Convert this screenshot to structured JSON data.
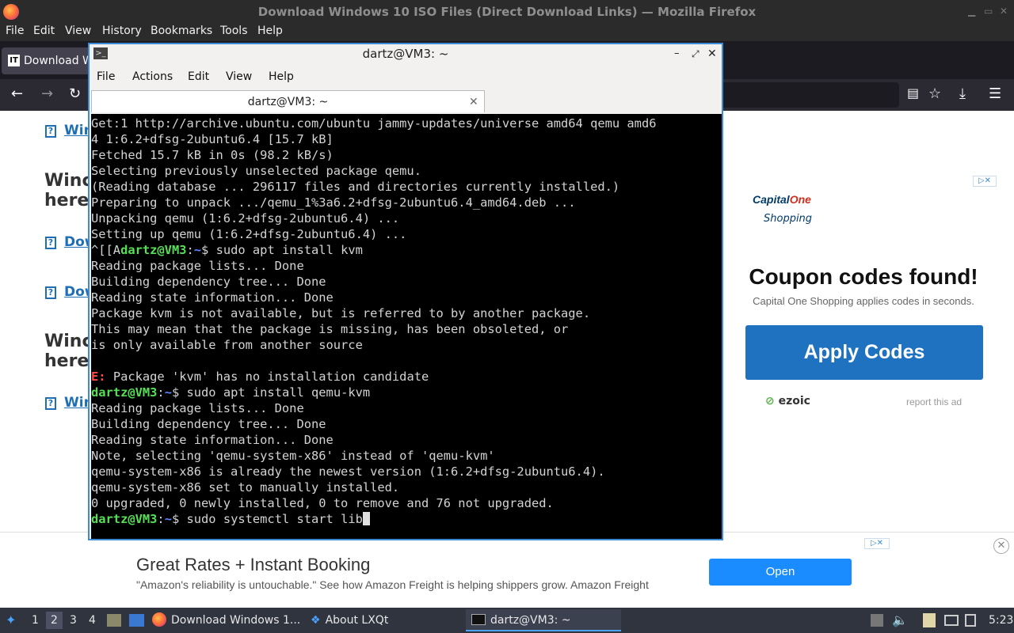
{
  "firefox": {
    "window_title": "Download Windows 10 ISO Files (Direct Download Links) — Mozilla Firefox",
    "menu": [
      "File",
      "Edit",
      "View",
      "History",
      "Bookmarks",
      "Tools",
      "Help"
    ],
    "tab_title": "Download W",
    "tab_icon_text": "IT"
  },
  "page": {
    "links": [
      "Win",
      "Dow",
      "Dow",
      "Win"
    ],
    "headings": [
      {
        "line1": "Winc",
        "line2": "here"
      },
      {
        "line1": "Winc",
        "line2": "here"
      }
    ],
    "ad_right": {
      "brand_top": "Capital",
      "brand_bottom": "One",
      "brand_sub": "Shopping",
      "headline": "Coupon codes found!",
      "sub": "Capital One Shopping applies codes in seconds.",
      "button": "Apply Codes",
      "ezoic": "ezoic",
      "report": "report this ad"
    },
    "ad_bottom": {
      "title": "Great Rates + Instant Booking",
      "desc": "\"Amazon's reliability is untouchable.\" See how Amazon Freight is helping shippers grow. Amazon Freight",
      "button": "Open"
    }
  },
  "terminal": {
    "title": "dartz@VM3: ~",
    "menu": [
      "File",
      "Actions",
      "Edit",
      "View",
      "Help"
    ],
    "tab": "dartz@VM3: ~",
    "lines": [
      {
        "t": "Get:1 http://archive.ubuntu.com/ubuntu jammy-updates/universe amd64 qemu amd6"
      },
      {
        "t": "4 1:6.2+dfsg-2ubuntu6.4 [15.7 kB]"
      },
      {
        "t": "Fetched 15.7 kB in 0s (98.2 kB/s)"
      },
      {
        "t": "Selecting previously unselected package qemu."
      },
      {
        "t": "(Reading database ... 296117 files and directories currently installed.)"
      },
      {
        "t": "Preparing to unpack .../qemu_1%3a6.2+dfsg-2ubuntu6.4_amd64.deb ..."
      },
      {
        "t": "Unpacking qemu (1:6.2+dfsg-2ubuntu6.4) ..."
      },
      {
        "t": "Setting up qemu (1:6.2+dfsg-2ubuntu6.4) ..."
      },
      {
        "pre": "^[[A",
        "user": "dartz@VM3",
        "path": "~",
        "cmd": "$ sudo apt install kvm"
      },
      {
        "t": "Reading package lists... Done"
      },
      {
        "t": "Building dependency tree... Done"
      },
      {
        "t": "Reading state information... Done"
      },
      {
        "t": "Package kvm is not available, but is referred to by another package."
      },
      {
        "t": "This may mean that the package is missing, has been obsoleted, or"
      },
      {
        "t": "is only available from another source"
      },
      {
        "t": ""
      },
      {
        "err": "E:",
        "t": " Package 'kvm' has no installation candidate"
      },
      {
        "user": "dartz@VM3",
        "path": "~",
        "cmd": "$ sudo apt install qemu-kvm"
      },
      {
        "t": "Reading package lists... Done"
      },
      {
        "t": "Building dependency tree... Done"
      },
      {
        "t": "Reading state information... Done"
      },
      {
        "t": "Note, selecting 'qemu-system-x86' instead of 'qemu-kvm'"
      },
      {
        "t": "qemu-system-x86 is already the newest version (1:6.2+dfsg-2ubuntu6.4)."
      },
      {
        "t": "qemu-system-x86 set to manually installed."
      },
      {
        "t": "0 upgraded, 0 newly installed, 0 to remove and 76 not upgraded."
      },
      {
        "user": "dartz@VM3",
        "path": "~",
        "cmd": "$ sudo systemctl start lib",
        "cursor": true
      }
    ]
  },
  "taskbar": {
    "workspaces": [
      "1",
      "2",
      "3",
      "4"
    ],
    "active_workspace": "2",
    "tasks": [
      "Download Windows 1...",
      "About LXQt",
      "dartz@VM3: ~"
    ],
    "clock": "5:23"
  }
}
